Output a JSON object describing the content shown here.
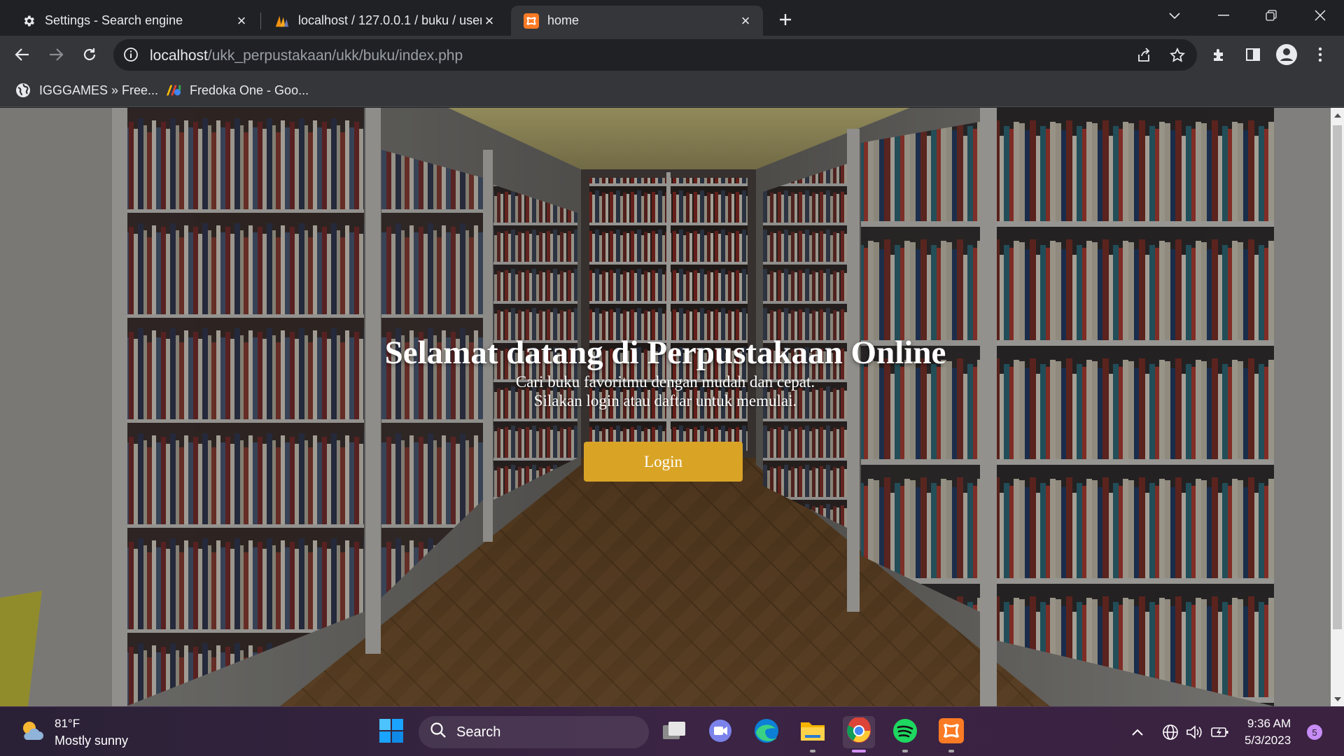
{
  "browser": {
    "tabs": [
      {
        "title": "Settings - Search engine",
        "icon": "gear-icon",
        "active": false
      },
      {
        "title": "localhost / 127.0.0.1 / buku / user",
        "icon": "phpmyadmin-icon",
        "active": false
      },
      {
        "title": "home",
        "icon": "xampp-icon",
        "active": true
      }
    ],
    "url": {
      "host": "localhost",
      "path": "/ukk_perpustakaan/ukk/buku/index.php"
    },
    "bookmarks": [
      {
        "label": "IGGGAMES » Free...",
        "icon": "globe-icon"
      },
      {
        "label": "Fredoka One - Goo...",
        "icon": "google-fonts-icon"
      }
    ]
  },
  "page": {
    "title": "Selamat datang di Perpustakaan Online",
    "subtitle_line1": "Cari buku favoritmu dengan mudah dan cepat.",
    "subtitle_line2": "Silakan login atau daftar untuk memulai.",
    "login_label": "Login",
    "accent_color": "#d9a426"
  },
  "taskbar": {
    "weather_temp": "81°F",
    "weather_desc": "Mostly sunny",
    "search_label": "Search",
    "time": "9:36 AM",
    "date": "5/3/2023",
    "notification_count": "5",
    "pinned_apps": [
      "start-icon",
      "task-view-icon",
      "teams-chat-icon",
      "edge-icon",
      "file-explorer-icon",
      "chrome-icon",
      "spotify-icon",
      "xampp-icon"
    ]
  }
}
